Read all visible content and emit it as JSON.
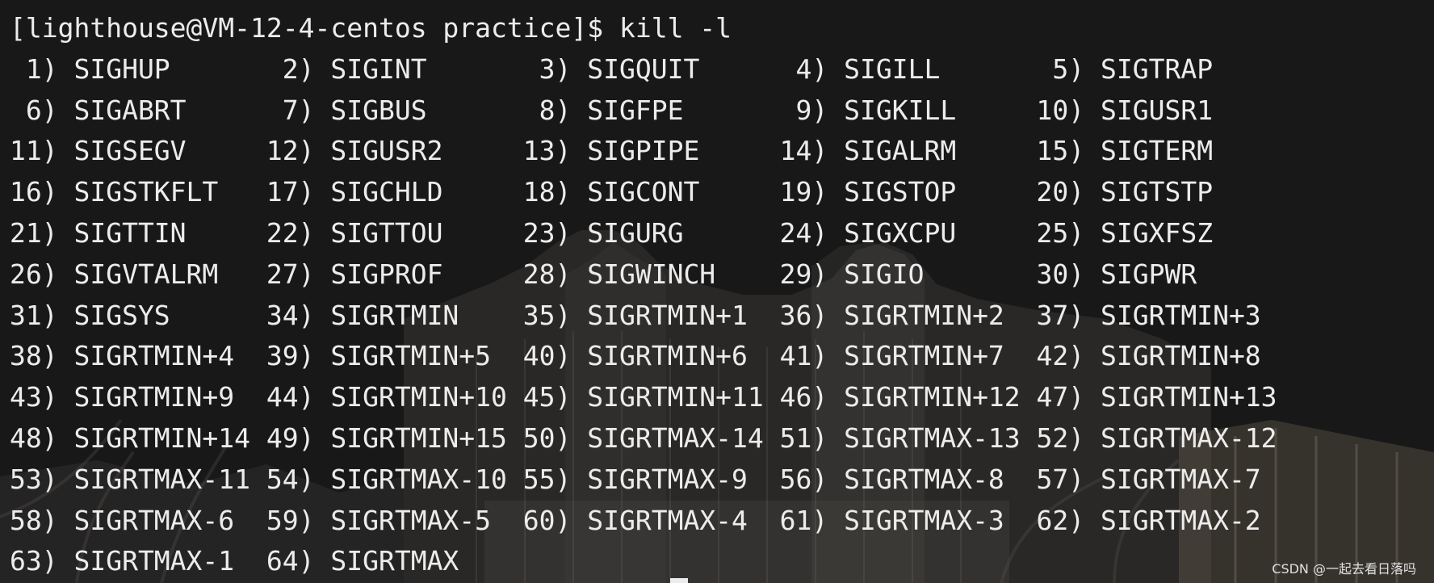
{
  "terminal": {
    "top_clipped_text": "",
    "prompt": "[lighthouse@VM-12-4-centos practice]$ kill -l",
    "lines": [
      " 1) SIGHUP\t 2) SIGINT\t 3) SIGQUIT\t 4) SIGILL\t 5) SIGTRAP",
      " 6) SIGABRT\t 7) SIGBUS\t 8) SIGFPE\t 9) SIGKILL\t10) SIGUSR1",
      "11) SIGSEGV\t12) SIGUSR2\t13) SIGPIPE\t14) SIGALRM\t15) SIGTERM",
      "16) SIGSTKFLT\t17) SIGCHLD\t18) SIGCONT\t19) SIGSTOP\t20) SIGTSTP",
      "21) SIGTTIN\t22) SIGTTOU\t23) SIGURG\t24) SIGXCPU\t25) SIGXFSZ",
      "26) SIGVTALRM\t27) SIGPROF\t28) SIGWINCH\t29) SIGIO\t30) SIGPWR",
      "31) SIGSYS\t34) SIGRTMIN\t35) SIGRTMIN+1\t36) SIGRTMIN+2\t37) SIGRTMIN+3",
      "38) SIGRTMIN+4\t39) SIGRTMIN+5\t40) SIGRTMIN+6\t41) SIGRTMIN+7\t42) SIGRTMIN+8",
      "43) SIGRTMIN+9\t44) SIGRTMIN+10\t45) SIGRTMIN+11\t46) SIGRTMIN+12\t47) SIGRTMIN+13",
      "48) SIGRTMIN+14\t49) SIGRTMIN+15\t50) SIGRTMAX-14\t51) SIGRTMAX-13\t52) SIGRTMAX-12",
      "53) SIGRTMAX-11\t54) SIGRTMAX-10\t55) SIGRTMAX-9\t56) SIGRTMAX-8\t57) SIGRTMAX-7",
      "58) SIGRTMAX-6\t59) SIGRTMAX-5\t60) SIGRTMAX-4\t61) SIGRTMAX-3\t62) SIGRTMAX-2",
      "63) SIGRTMAX-1\t64) SIGRTMAX"
    ]
  },
  "watermark": {
    "text": "CSDN @一起去看日落吗"
  },
  "colors": {
    "text": "#ececec",
    "background": "#181818"
  }
}
